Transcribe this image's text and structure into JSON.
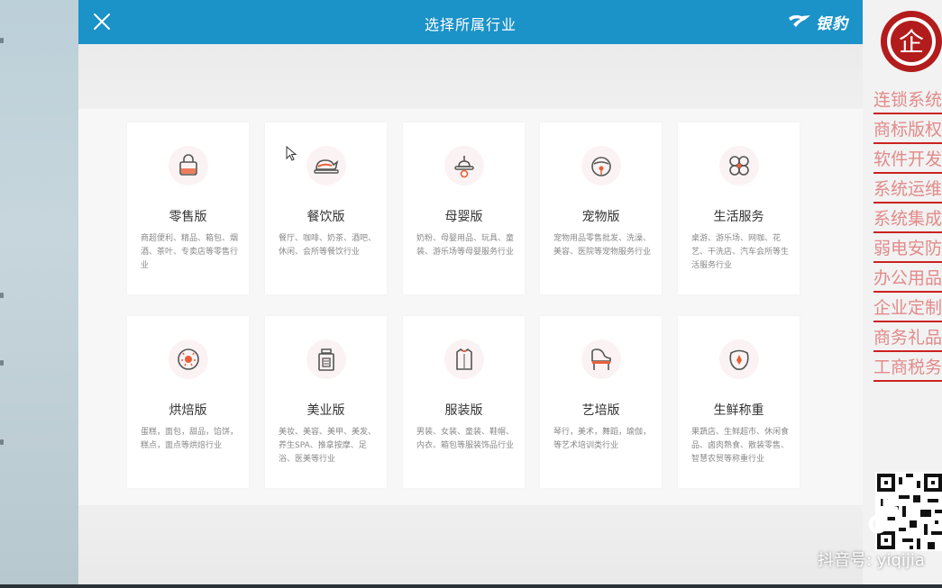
{
  "dialog": {
    "title": "选择所属行业",
    "logo": "银豹"
  },
  "cards": [
    {
      "name": "零售版",
      "desc": "商超便利、精品、箱包、烟酒、茶叶、专卖店等零售行业",
      "icon": "shopping-bag-icon"
    },
    {
      "name": "餐饮版",
      "desc": "餐厅、咖啡、奶茶、酒吧、休闲、会所等餐饮行业",
      "icon": "roast-chicken-icon"
    },
    {
      "name": "母婴版",
      "desc": "奶粉、母婴用品、玩具、童装、游乐场等母婴服务行业",
      "icon": "pacifier-icon"
    },
    {
      "name": "宠物版",
      "desc": "宠物用品零售批发、洗澡、美容、医院等宠物服务行业",
      "icon": "pet-bell-icon"
    },
    {
      "name": "生活服务",
      "desc": "桌游、游乐场、网咖、花艺、干洗店、汽车会所等生活服务行业",
      "icon": "clover-icon"
    },
    {
      "name": "烘焙版",
      "desc": "蛋糕，面包，甜品，馅饼，糕点，面点等烘焙行业",
      "icon": "donut-icon"
    },
    {
      "name": "美业版",
      "desc": "美妆、美容、美甲、美发、养生SPA、推拿按摩、足浴、医美等行业",
      "icon": "perfume-bottle-icon"
    },
    {
      "name": "服装版",
      "desc": "男装、女装、童装、鞋帽、内衣、箱包等服装饰品行业",
      "icon": "shirt-icon"
    },
    {
      "name": "艺培版",
      "desc": "琴行，美术，舞蹈，瑜伽，等艺术培训类行业",
      "icon": "piano-icon"
    },
    {
      "name": "生鲜称重",
      "desc": "果蔬店、生鲜超市、休闲食品、卤肉熟食、散装零售、智慧农贸等称重行业",
      "icon": "fish-icon"
    }
  ],
  "side_panel": {
    "menu": [
      "连锁系统",
      "商标版权",
      "软件开发",
      "系统运维",
      "系统集成",
      "弱电安防",
      "办公用品",
      "企业定制",
      "商务礼品",
      "工商税务"
    ],
    "seal_char": "企",
    "watermark": "抖音号: yiqijia"
  },
  "colors": {
    "header": "#1b92c8",
    "accent": "#e8603a",
    "side_text": "#e28a8a",
    "side_line": "#cc2222"
  }
}
